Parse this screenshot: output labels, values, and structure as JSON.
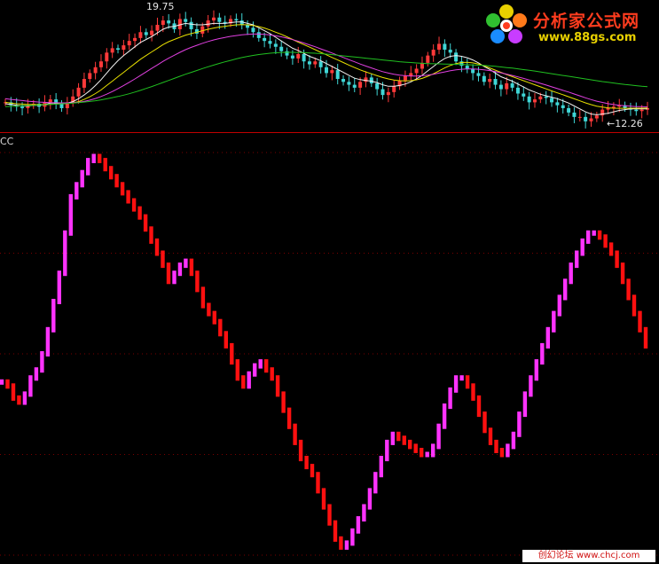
{
  "upper_panel": {
    "high_label": "19.75",
    "low_label": "←12.26"
  },
  "lower_panel": {
    "indicator_label": "CC"
  },
  "watermark": {
    "name": "分析家公式网",
    "url": "www.88gs.com"
  },
  "footer": {
    "text": "创幻论坛 www.chcj.com"
  },
  "colors": {
    "background": "#000000",
    "divider": "#c00000",
    "grid": "#7a0000",
    "candle_up": "#ff3a3a",
    "candle_down": "#3fd6d6",
    "ma_white": "#f2f2f2",
    "ma_yellow": "#e8e000",
    "ma_magenta": "#e040e0",
    "ma_green": "#20c020",
    "indicator_rising": "#ff33ff",
    "indicator_falling": "#ff1010"
  },
  "chart_data": [
    {
      "type": "candlestick",
      "title": "",
      "ylim": [
        11.5,
        20.6
      ],
      "annotations": [
        {
          "text": "19.75",
          "x": 37,
          "y": 19.75
        },
        {
          "text": "←12.26",
          "x": 170,
          "y": 12.26
        }
      ],
      "close": [
        13.6,
        13.4,
        13.3,
        13.2,
        13.4,
        13.5,
        13.3,
        13.6,
        13.8,
        13.5,
        13.2,
        13.6,
        14.0,
        14.6,
        15.2,
        15.6,
        16.0,
        16.4,
        17.0,
        17.3,
        17.2,
        17.5,
        17.8,
        18.0,
        18.4,
        18.2,
        18.5,
        18.9,
        19.2,
        19.0,
        18.6,
        19.3,
        19.1,
        18.6,
        18.3,
        18.8,
        19.2,
        19.4,
        19.1,
        19.0,
        19.3,
        19.2,
        18.9,
        18.7,
        18.4,
        18.0,
        17.8,
        17.6,
        17.4,
        17.1,
        16.8,
        16.6,
        16.9,
        16.4,
        16.2,
        16.4,
        16.0,
        15.6,
        15.8,
        15.2,
        15.0,
        14.8,
        14.6,
        15.0,
        15.3,
        14.9,
        14.5,
        14.1,
        14.3,
        14.7,
        15.1,
        15.4,
        15.6,
        15.9,
        16.3,
        16.8,
        17.2,
        17.6,
        17.2,
        17.0,
        16.4,
        16.1,
        15.9,
        15.6,
        15.4,
        15.0,
        15.2,
        14.8,
        14.5,
        14.9,
        14.6,
        14.2,
        14.0,
        13.6,
        13.8,
        14.0,
        13.9,
        13.6,
        13.4,
        13.2,
        12.9,
        12.6,
        12.6,
        12.3,
        12.5,
        12.7,
        13.1,
        13.2,
        13.3,
        13.4,
        13.2,
        13.1,
        13.0,
        13.1,
        13.2
      ],
      "series": [
        {
          "name": "",
          "color": "#f2f2f2",
          "values": [
            13.5,
            13.45,
            13.4,
            13.35,
            13.35,
            13.4,
            13.4,
            13.45,
            13.55,
            13.55,
            13.5,
            13.55,
            13.65,
            13.85,
            14.1,
            14.4,
            14.75,
            15.15,
            15.6,
            16.05,
            16.45,
            16.8,
            17.1,
            17.4,
            17.7,
            17.9,
            18.1,
            18.35,
            18.6,
            18.75,
            18.8,
            18.9,
            19.0,
            18.95,
            18.9,
            18.9,
            18.95,
            19.0,
            19.0,
            19.0,
            19.05,
            19.1,
            19.1,
            19.0,
            18.9,
            18.7,
            18.5,
            18.3,
            18.05,
            17.8,
            17.55,
            17.3,
            17.15,
            16.95,
            16.75,
            16.6,
            16.45,
            16.25,
            16.05,
            15.85,
            15.65,
            15.45,
            15.25,
            15.15,
            15.1,
            15.05,
            14.95,
            14.8,
            14.7,
            14.7,
            14.75,
            14.85,
            15.0,
            15.2,
            15.45,
            15.75,
            16.05,
            16.35,
            16.6,
            16.75,
            16.8,
            16.75,
            16.65,
            16.5,
            16.3,
            16.05,
            15.85,
            15.6,
            15.35,
            15.2,
            15.05,
            14.85,
            14.65,
            14.45,
            14.3,
            14.15,
            14.05,
            13.95,
            13.85,
            13.7,
            13.55,
            13.35,
            13.15,
            12.95,
            12.8,
            12.75,
            12.8,
            12.85,
            12.95,
            13.05,
            13.1,
            13.15,
            13.15,
            13.15,
            13.15
          ]
        },
        {
          "name": "",
          "color": "#e8e000",
          "values": [
            13.6,
            13.55,
            13.5,
            13.48,
            13.46,
            13.45,
            13.44,
            13.44,
            13.46,
            13.48,
            13.5,
            13.52,
            13.56,
            13.65,
            13.8,
            13.98,
            14.2,
            14.45,
            14.75,
            15.05,
            15.35,
            15.65,
            15.95,
            16.25,
            16.55,
            16.8,
            17.05,
            17.3,
            17.55,
            17.75,
            17.9,
            18.05,
            18.2,
            18.3,
            18.4,
            18.5,
            18.6,
            18.68,
            18.75,
            18.8,
            18.85,
            18.9,
            18.92,
            18.9,
            18.85,
            18.78,
            18.68,
            18.55,
            18.4,
            18.25,
            18.08,
            17.9,
            17.72,
            17.55,
            17.38,
            17.2,
            17.02,
            16.85,
            16.67,
            16.5,
            16.32,
            16.15,
            15.98,
            15.82,
            15.68,
            15.55,
            15.42,
            15.3,
            15.2,
            15.12,
            15.08,
            15.06,
            15.08,
            15.14,
            15.24,
            15.38,
            15.55,
            15.75,
            15.95,
            16.12,
            16.25,
            16.32,
            16.34,
            16.3,
            16.22,
            16.1,
            15.95,
            15.8,
            15.65,
            15.5,
            15.36,
            15.22,
            15.08,
            14.94,
            14.8,
            14.66,
            14.52,
            14.38,
            14.25,
            14.12,
            13.98,
            13.84,
            13.7,
            13.56,
            13.44,
            13.34,
            13.27,
            13.22,
            13.2,
            13.19,
            13.19,
            13.2,
            13.2,
            13.2,
            13.21
          ]
        },
        {
          "name": "",
          "color": "#e040e0",
          "values": [
            13.85,
            13.8,
            13.76,
            13.72,
            13.68,
            13.65,
            13.62,
            13.6,
            13.58,
            13.57,
            13.56,
            13.56,
            13.57,
            13.6,
            13.66,
            13.75,
            13.86,
            14.0,
            14.16,
            14.34,
            14.54,
            14.75,
            14.97,
            15.2,
            15.44,
            15.68,
            15.92,
            16.16,
            16.4,
            16.62,
            16.82,
            17.02,
            17.2,
            17.36,
            17.5,
            17.64,
            17.76,
            17.87,
            17.96,
            18.04,
            18.11,
            18.17,
            18.22,
            18.25,
            18.27,
            18.27,
            18.25,
            18.21,
            18.15,
            18.08,
            17.99,
            17.89,
            17.78,
            17.66,
            17.53,
            17.4,
            17.26,
            17.12,
            16.97,
            16.82,
            16.67,
            16.52,
            16.37,
            16.22,
            16.08,
            15.95,
            15.82,
            15.7,
            15.6,
            15.52,
            15.46,
            15.42,
            15.4,
            15.4,
            15.42,
            15.46,
            15.52,
            15.6,
            15.68,
            15.76,
            15.82,
            15.86,
            15.88,
            15.88,
            15.86,
            15.82,
            15.77,
            15.7,
            15.62,
            15.53,
            15.44,
            15.34,
            15.24,
            15.13,
            15.02,
            14.9,
            14.78,
            14.66,
            14.54,
            14.42,
            14.3,
            14.17,
            14.04,
            13.91,
            13.79,
            13.68,
            13.59,
            13.51,
            13.45,
            13.4,
            13.36,
            13.33,
            13.31,
            13.3,
            13.29
          ]
        },
        {
          "name": "",
          "color": "#20c020",
          "values": [
            13.3,
            13.32,
            13.34,
            13.36,
            13.38,
            13.4,
            13.42,
            13.44,
            13.46,
            13.48,
            13.5,
            13.52,
            13.55,
            13.58,
            13.62,
            13.66,
            13.71,
            13.77,
            13.84,
            13.92,
            14.0,
            14.09,
            14.19,
            14.3,
            14.42,
            14.55,
            14.68,
            14.82,
            14.96,
            15.1,
            15.24,
            15.38,
            15.52,
            15.65,
            15.78,
            15.91,
            16.03,
            16.15,
            16.26,
            16.37,
            16.47,
            16.57,
            16.66,
            16.74,
            16.81,
            16.87,
            16.92,
            16.96,
            16.99,
            17.01,
            17.02,
            17.02,
            17.01,
            17.0,
            16.98,
            16.96,
            16.93,
            16.9,
            16.86,
            16.82,
            16.78,
            16.74,
            16.7,
            16.66,
            16.62,
            16.58,
            16.54,
            16.5,
            16.46,
            16.42,
            16.38,
            16.35,
            16.32,
            16.29,
            16.27,
            16.25,
            16.24,
            16.23,
            16.22,
            16.21,
            16.2,
            16.19,
            16.18,
            16.16,
            16.14,
            16.12,
            16.09,
            16.06,
            16.02,
            15.98,
            15.94,
            15.89,
            15.84,
            15.79,
            15.74,
            15.68,
            15.62,
            15.56,
            15.5,
            15.44,
            15.38,
            15.32,
            15.26,
            15.2,
            15.14,
            15.08,
            15.02,
            14.97,
            14.92,
            14.87,
            14.82,
            14.78,
            14.74,
            14.7,
            14.67
          ]
        }
      ]
    },
    {
      "type": "line",
      "title": "CC",
      "ylim": [
        0,
        100
      ],
      "x_count": 113,
      "values": [
        43,
        42,
        39,
        38,
        40,
        44,
        46,
        50,
        56,
        63,
        70,
        80,
        89,
        92,
        95,
        98,
        99,
        98,
        96,
        94,
        92,
        90,
        88,
        86,
        84,
        81,
        78,
        75,
        72,
        68,
        70,
        72,
        73,
        70,
        66,
        62,
        60,
        58,
        55,
        52,
        48,
        44,
        42,
        45,
        47,
        48,
        46,
        44,
        40,
        36,
        32,
        28,
        24,
        22,
        20,
        16,
        12,
        8,
        4,
        2,
        3,
        6,
        9,
        12,
        16,
        20,
        24,
        28,
        30,
        29,
        28,
        27,
        26,
        25,
        25,
        27,
        32,
        37,
        41,
        44,
        44,
        42,
        39,
        35,
        31,
        28,
        26,
        25,
        27,
        30,
        35,
        40,
        44,
        48,
        52,
        56,
        60,
        64,
        68,
        72,
        75,
        78,
        80,
        80,
        79,
        77,
        75,
        72,
        68,
        64,
        60,
        56,
        52
      ]
    }
  ]
}
